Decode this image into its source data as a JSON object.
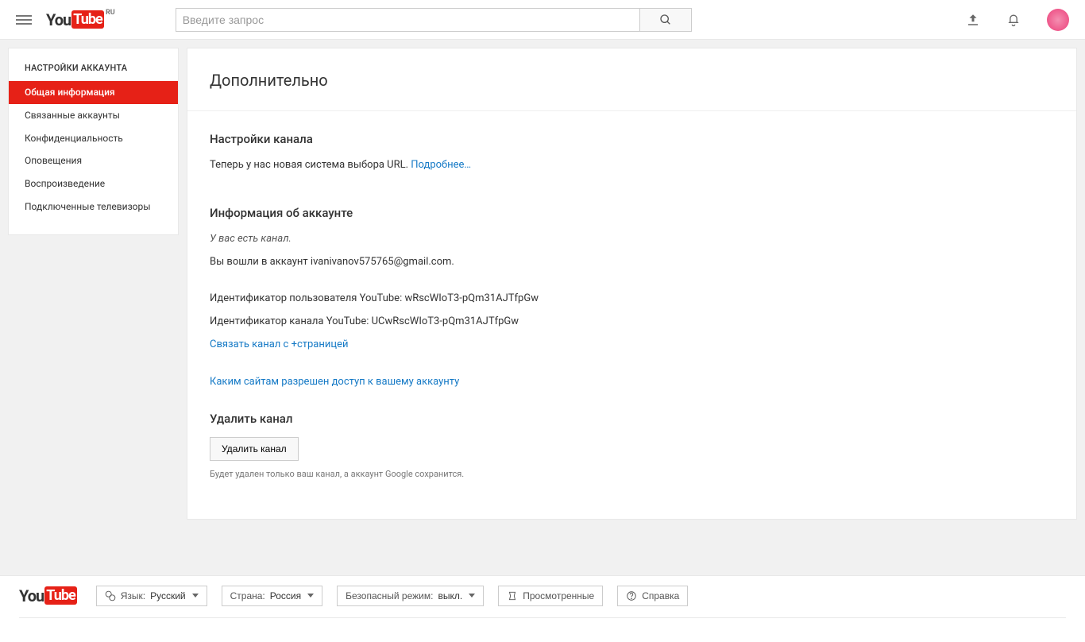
{
  "header": {
    "logo_you": "You",
    "logo_tube": "Tube",
    "logo_region": "RU",
    "search_placeholder": "Введите запрос"
  },
  "sidebar": {
    "title": "НАСТРОЙКИ АККАУНТА",
    "items": [
      {
        "label": "Общая информация",
        "active": true
      },
      {
        "label": "Связанные аккаунты"
      },
      {
        "label": "Конфиденциальность"
      },
      {
        "label": "Оповещения"
      },
      {
        "label": "Воспроизведение"
      },
      {
        "label": "Подключенные телевизоры"
      }
    ]
  },
  "main": {
    "title": "Дополнительно",
    "channel_settings": {
      "heading": "Настройки канала",
      "text": "Теперь у нас новая система выбора URL. ",
      "more_link": "Подробнее…"
    },
    "account_info": {
      "heading": "Информация об аккаунте",
      "you_have_channel": "У вас есть канал.",
      "logged_in": "Вы вошли в аккаунт ivanivanov575765@gmail.com.",
      "user_id": "Идентификатор пользователя YouTube: wRscWIoT3-pQm31AJTfpGw",
      "channel_id": "Идентификатор канала YouTube: UCwRscWIoT3-pQm31AJTfpGw",
      "link_plus_page": "Связать канал с +страницей",
      "site_access": "Каким сайтам разрешен доступ к вашему аккаунту"
    },
    "delete_channel": {
      "heading": "Удалить канал",
      "button": "Удалить канал",
      "note": "Будет удален только ваш канал, а аккаунт Google сохранится."
    }
  },
  "footer": {
    "language_label": "Язык: ",
    "language_value": "Русский",
    "country_label": "Страна: ",
    "country_value": "Россия",
    "safety_label": "Безопасный режим: ",
    "safety_value": "выкл.",
    "history": "Просмотренные",
    "help": "Справка"
  }
}
